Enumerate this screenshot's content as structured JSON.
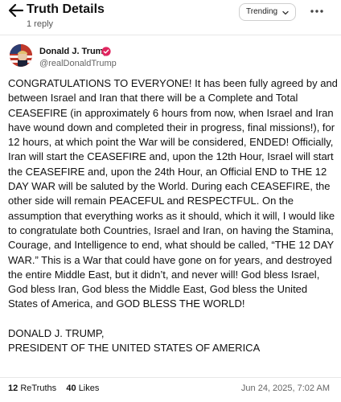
{
  "header": {
    "title": "Truth Details",
    "reply_count": "1 reply",
    "sort_select": {
      "selected": "Trending"
    },
    "icons": [
      "back-arrow-icon",
      "chevron-down-icon",
      "more-icon"
    ]
  },
  "post": {
    "author": {
      "name": "Donald J. Trump",
      "handle": "@realDonaldTrump",
      "verified_color": "#e0245e"
    },
    "body": "CONGRATULATIONS TO EVERYONE! It has been fully agreed by and between Israel and Iran that there will be a Complete and Total CEASEFIRE (in approximately 6 hours from now, when Israel and Iran have wound down and completed their in progress, final missions!), for 12 hours, at which point the War will be considered, ENDED! Officially, Iran will start the CEASEFIRE and, upon the 12th Hour, Israel will start the CEASEFIRE and, upon the 24th Hour, an Official END to THE 12 DAY WAR will be saluted by the World. During each CEASEFIRE, the other side will remain PEACEFUL and RESPECTFUL. On the assumption that everything works as it should, which it will, I would like to congratulate both Countries, Israel and Iran, on having the Stamina, Courage, and Intelligence to end, what should be called, “THE 12 DAY WAR.” This is a War that could have gone on for years, and destroyed the entire Middle East, but it didn’t, and never will! God bless Israel, God bless Iran, God bless the Middle East, God bless the United States of America, and GOD BLESS THE WORLD!",
    "signature_line1": "DONALD J. TRUMP,",
    "signature_line2": "PRESIDENT OF THE UNITED STATES OF AMERICA",
    "stats": {
      "retruths_count": "12",
      "retruths_label": "ReTruths",
      "likes_count": "40",
      "likes_label": "Likes"
    },
    "timestamp": "Jun 24, 2025, 7:02 AM"
  }
}
